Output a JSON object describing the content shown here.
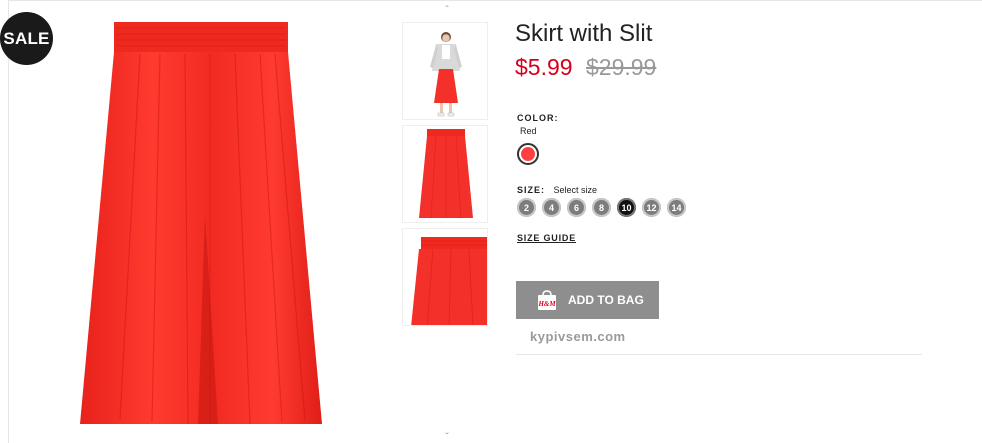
{
  "badge": {
    "text": "SALE"
  },
  "product": {
    "title": "Skirt with Slit",
    "price": "$5.99",
    "old_price": "$29.99",
    "color_label": "COLOR:",
    "color_value": "Red",
    "color_swatch": "#ff4040",
    "size_label": "SIZE:",
    "size_hint": "Select size",
    "sizes": [
      "2",
      "4",
      "6",
      "8",
      "10",
      "12",
      "14"
    ],
    "selected_size": "10",
    "size_guide": "SIZE GUIDE",
    "add_to_bag": "ADD TO BAG",
    "bag_icon_text": "H&M"
  },
  "watermark": "kypivsem.com",
  "colors": {
    "skirt": "#f4302a",
    "price_sale": "#d6001c",
    "button": "#8e8e8e"
  }
}
